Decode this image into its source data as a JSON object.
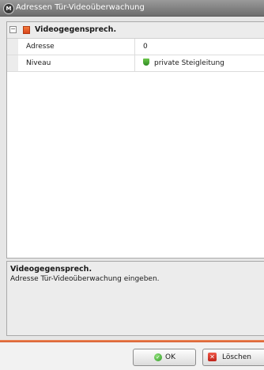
{
  "window": {
    "title": "Adressen Tür-Videoüberwachung"
  },
  "group": {
    "label": "Videogegensprech.",
    "collapse_symbol": "−",
    "icon": "orange-square-icon"
  },
  "properties": [
    {
      "name": "Adresse",
      "value": "0",
      "icon": null
    },
    {
      "name": "Niveau",
      "value": "private Steigleitung",
      "icon": "green-shield-icon"
    }
  ],
  "description": {
    "title": "Videogegensprech.",
    "text": "Adresse Tür-Videoüberwachung eingeben."
  },
  "buttons": {
    "ok_label": "OK",
    "ok_icon": "check-icon",
    "ok_icon_glyph": "✓",
    "delete_label": "Löschen",
    "delete_icon": "x-icon",
    "delete_icon_glyph": "✕"
  },
  "colors": {
    "accent": "#e8683a",
    "ok_green": "#2f9a24",
    "delete_red": "#c0231a"
  }
}
